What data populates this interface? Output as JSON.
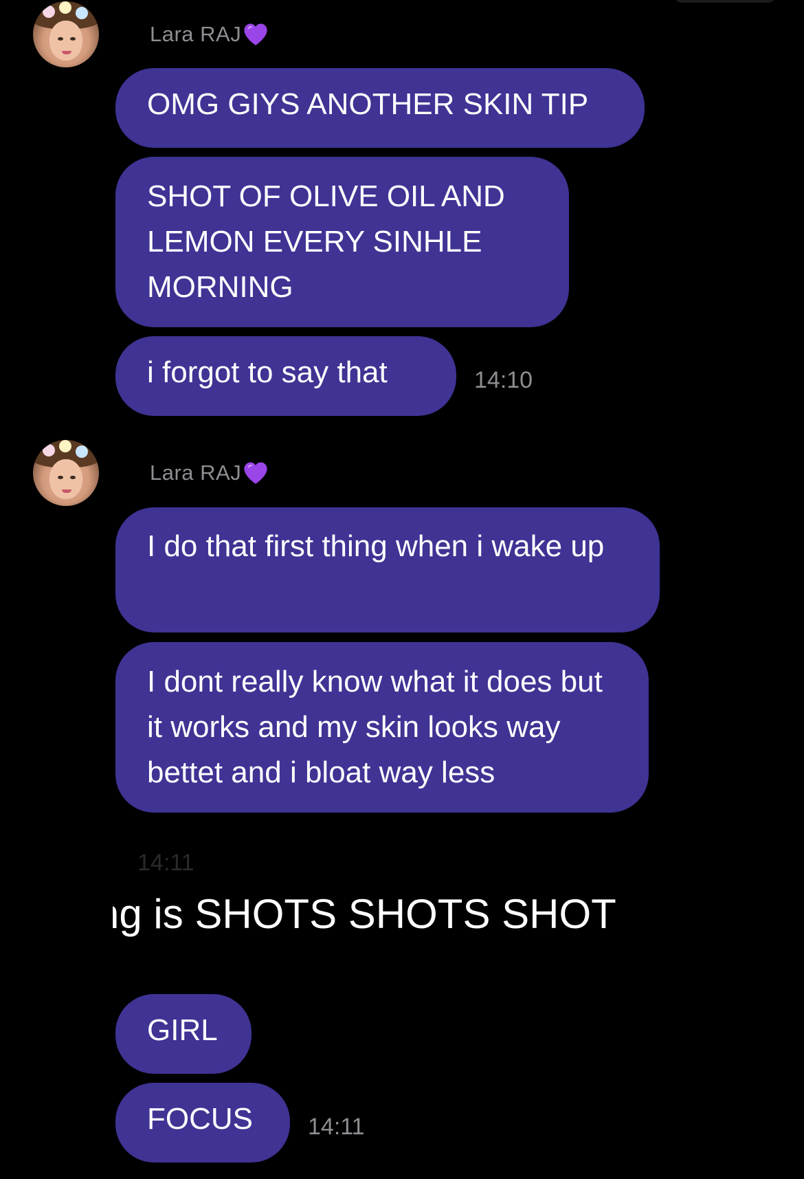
{
  "groups": [
    {
      "sender": "Lara RAJ",
      "messages": [
        "OMG GIYS ANOTHER SKIN TIP",
        "SHOT OF OLIVE OIL AND LEMON EVERY SINHLE MORNING",
        "i forgot to say that"
      ],
      "time": "14:10"
    },
    {
      "sender": "Lara RAJ",
      "messages": [
        "I do that first thing when i wake up",
        "I dont really know what it does but it works and my skin looks way bettet and i bloat way less"
      ]
    }
  ],
  "overlay": {
    "faded_time": "14:11",
    "caption": "ng is SHOTS SHOTS SHOT"
  },
  "reply": {
    "messages": [
      "GIRL",
      "FOCUS"
    ],
    "time": "14:11"
  },
  "colors": {
    "bubble": "#3f3394",
    "background": "#000000",
    "meta_text": "#8e8e93",
    "heart": "#8f3be0"
  },
  "icons": {
    "sender_badge": "purple-heart-icon"
  }
}
